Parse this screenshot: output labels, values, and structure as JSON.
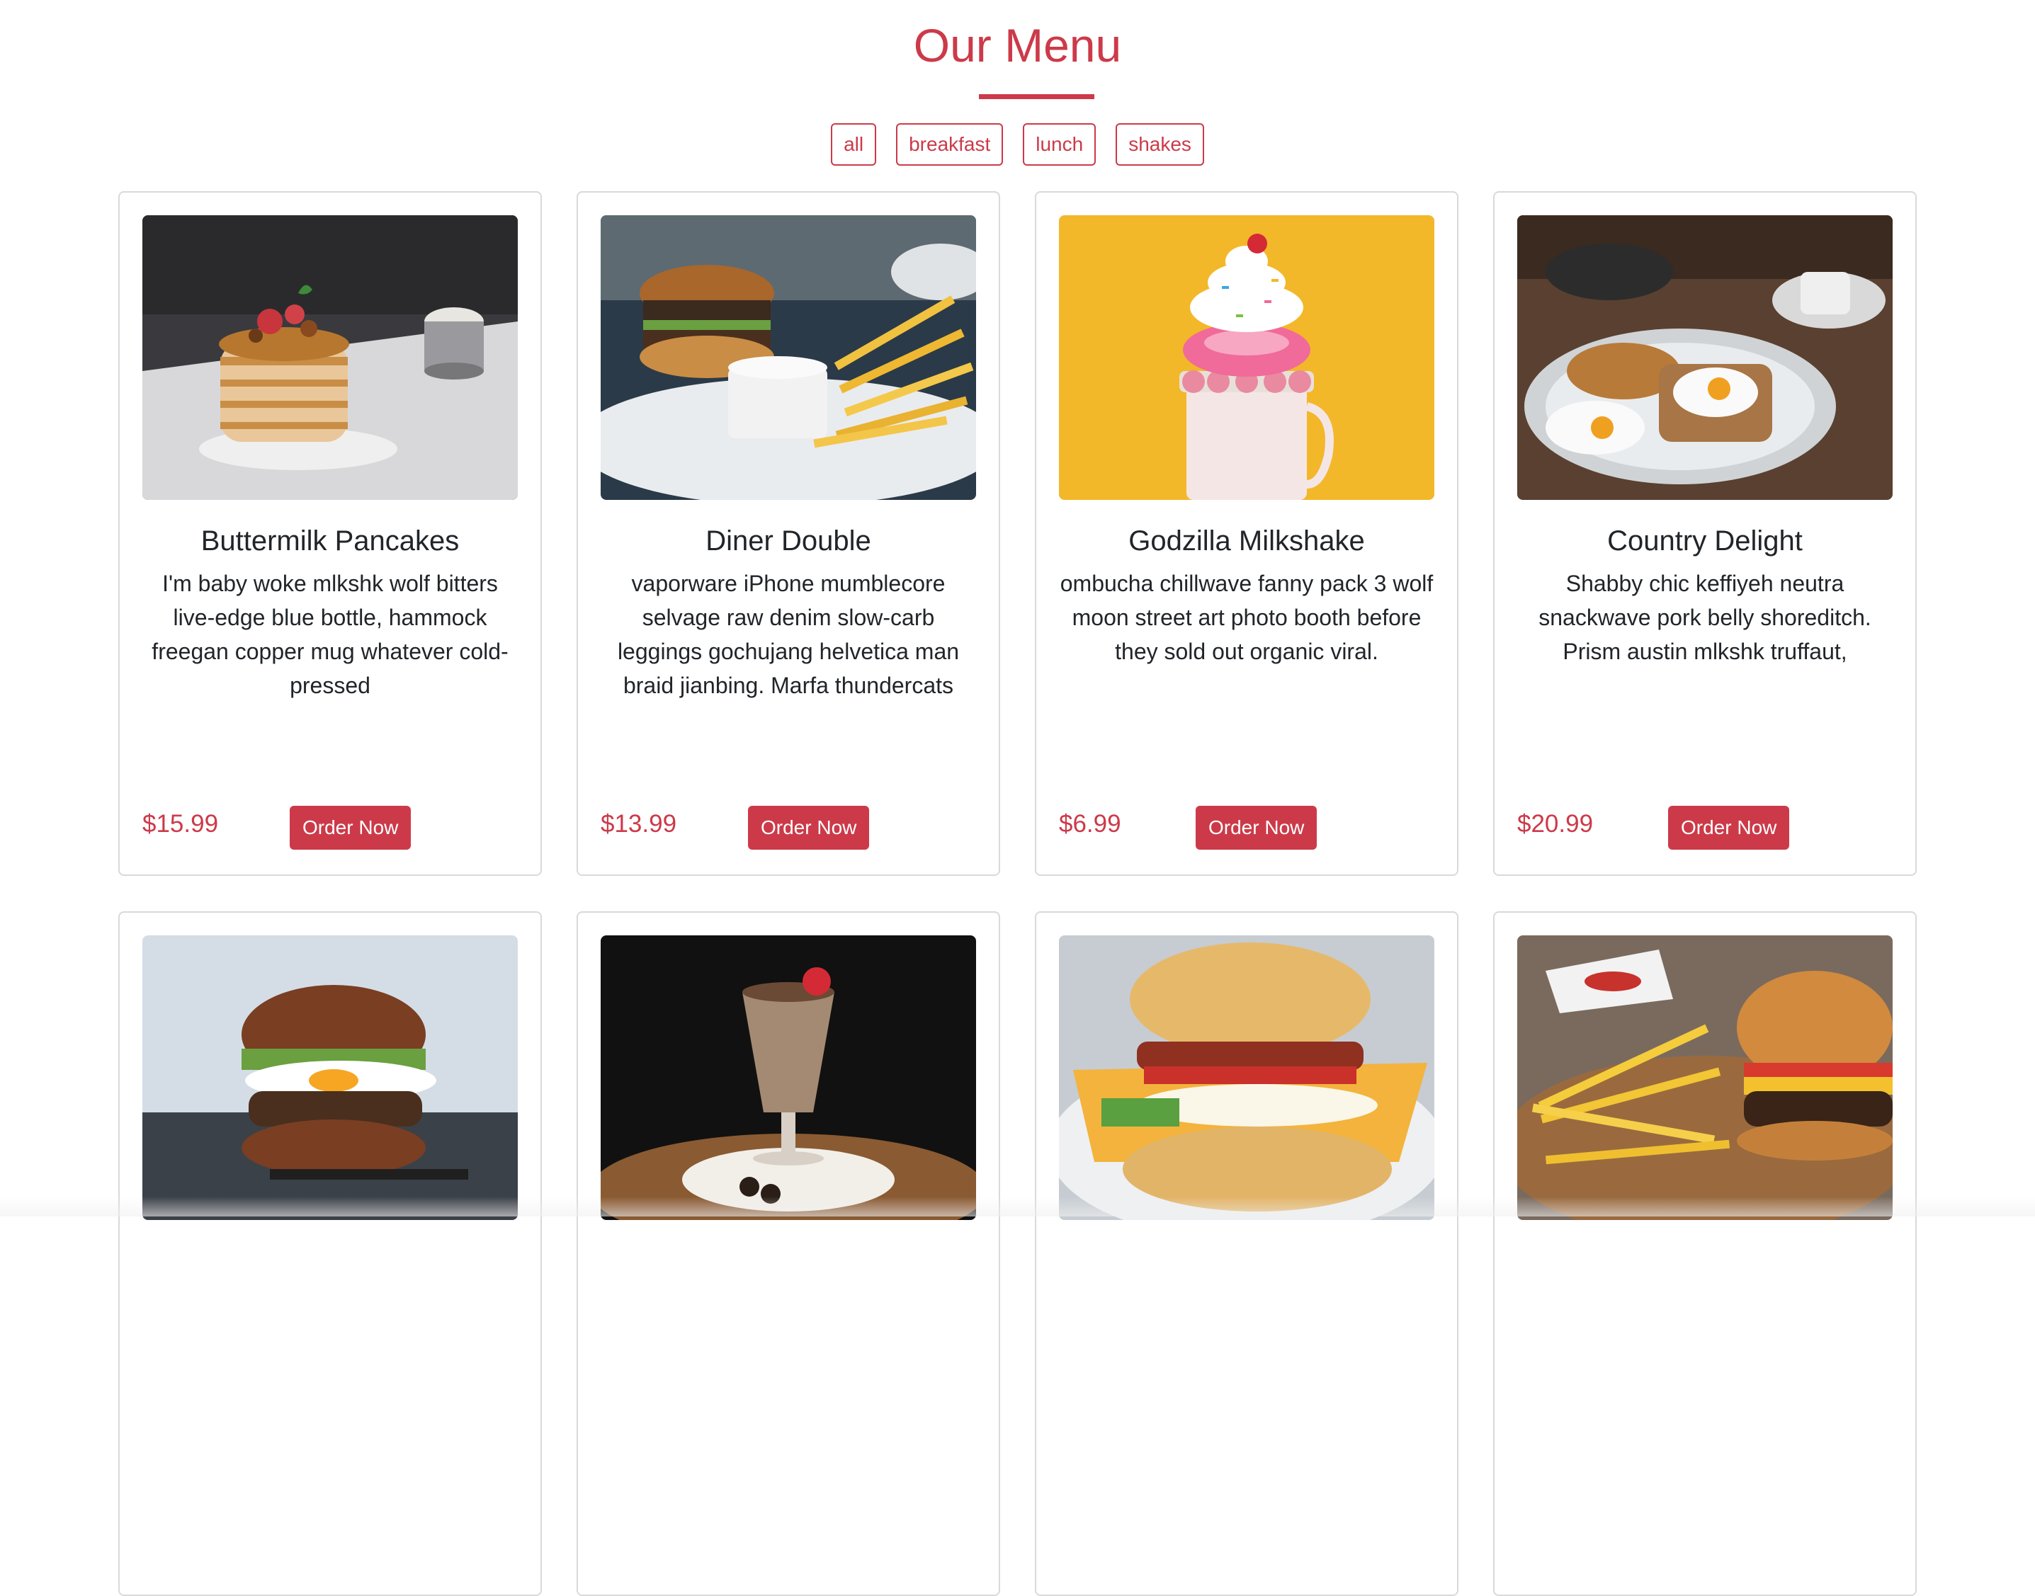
{
  "header": {
    "title": "Our Menu",
    "accent_color": "#cc3a49"
  },
  "filters": [
    {
      "label": "all"
    },
    {
      "label": "breakfast"
    },
    {
      "label": "lunch"
    },
    {
      "label": "shakes"
    }
  ],
  "menu": {
    "items": [
      {
        "title": "Buttermilk Pancakes",
        "description": "I'm baby woke mlkshk wolf bitters live-edge blue bottle, hammock freegan copper mug whatever cold-pressed",
        "price": "$15.99",
        "button": "Order Now",
        "photo": "pancakes-photo"
      },
      {
        "title": "Diner Double",
        "description": "vaporware iPhone mumblecore selvage raw denim slow-carb leggings gochujang helvetica man braid jianbing. Marfa thundercats",
        "price": "$13.99",
        "button": "Order Now",
        "photo": "burger-fries-photo"
      },
      {
        "title": "Godzilla Milkshake",
        "description": "ombucha chillwave fanny pack 3 wolf moon street art photo booth before they sold out organic viral.",
        "price": "$6.99",
        "button": "Order Now",
        "photo": "milkshake-photo"
      },
      {
        "title": "Country Delight",
        "description": "Shabby chic keffiyeh neutra snackwave pork belly shoreditch. Prism austin mlkshk truffaut,",
        "price": "$20.99",
        "button": "Order Now",
        "photo": "eggs-toast-photo"
      },
      {
        "photo": "egg-burger-photo"
      },
      {
        "photo": "chocolate-shake-photo"
      },
      {
        "photo": "bacon-biscuit-photo"
      },
      {
        "photo": "burger-fries-board-photo"
      }
    ]
  }
}
